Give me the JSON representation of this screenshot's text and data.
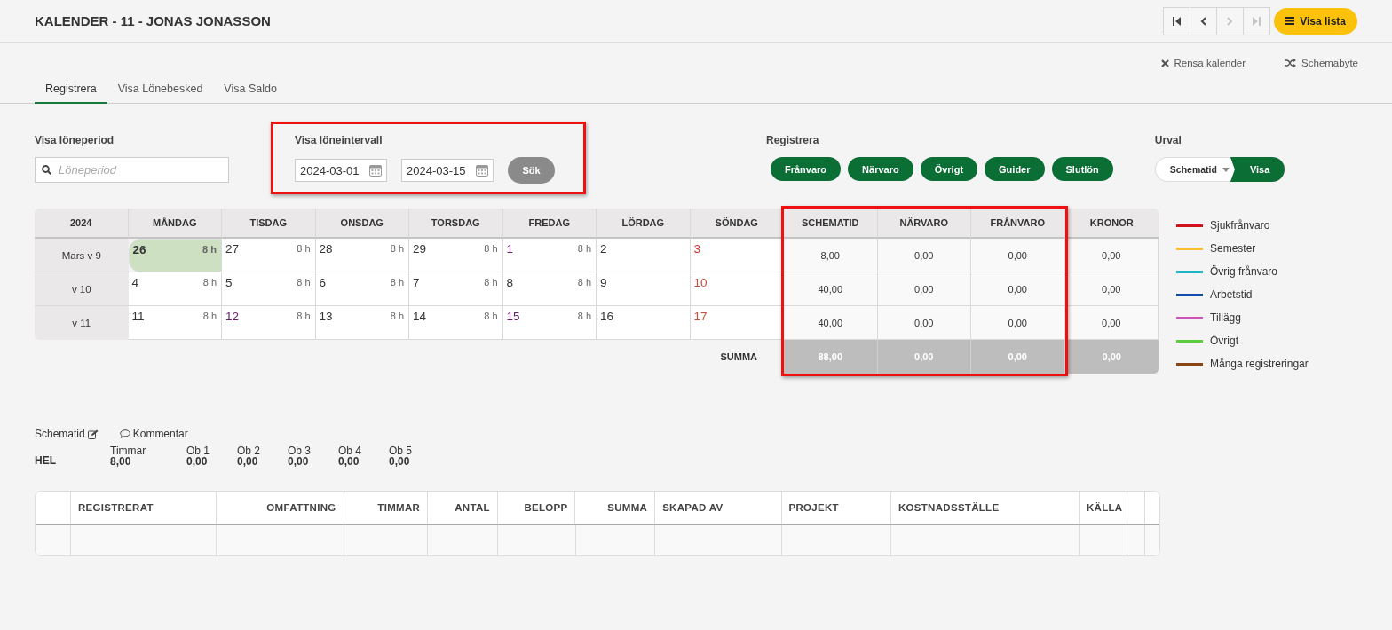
{
  "header": {
    "title": "KALENDER - 11 - JONAS JONASSON",
    "list_button": "Visa lista",
    "nav_buttons": [
      {
        "kind": "first",
        "disabled": false
      },
      {
        "kind": "prev",
        "disabled": false
      },
      {
        "kind": "next",
        "disabled": true
      },
      {
        "kind": "last",
        "disabled": true
      }
    ]
  },
  "actions": [
    {
      "kind": "clear",
      "label": "Rensa kalender"
    },
    {
      "kind": "shuffle",
      "label": "Schemabyte"
    }
  ],
  "tabs": [
    {
      "label": "Registrera",
      "selected": true
    },
    {
      "label": "Visa Lönebesked",
      "selected": false
    },
    {
      "label": "Visa Saldo",
      "selected": false
    }
  ],
  "period": {
    "label": "Visa löneperiod",
    "placeholder": "Löneperiod"
  },
  "interval": {
    "label": "Visa löneintervall",
    "from": "2024-03-01",
    "to": "2024-03-15",
    "button": "Sök",
    "highlighted": true
  },
  "register": {
    "label": "Registrera",
    "buttons": [
      "Frånvaro",
      "Närvaro",
      "Övrigt",
      "Guider",
      "Slutlön"
    ]
  },
  "selection": {
    "label": "Urval",
    "value": "Schematid",
    "button": "Visa"
  },
  "calendar": {
    "corner": "2024",
    "days": [
      "MÅNDAG",
      "TISDAG",
      "ONSDAG",
      "TORSDAG",
      "FREDAG",
      "LÖRDAG",
      "SÖNDAG"
    ],
    "summary_columns": [
      {
        "label": "SCHEMATID",
        "highlighted": true
      },
      {
        "label": "NÄRVARO",
        "highlighted": true
      },
      {
        "label": "FRÅNVARO",
        "highlighted": true
      },
      {
        "label": "KRONOR",
        "highlighted": false
      }
    ],
    "weeks": [
      {
        "label": "Mars v 9",
        "totals": [
          "8,00",
          "0,00",
          "0,00",
          "0,00"
        ],
        "days": [
          {
            "date": "26",
            "hours": "8 h",
            "selected": true,
            "color": "#333333"
          },
          {
            "date": "27",
            "hours": "8 h",
            "selected": false,
            "color": "#333333"
          },
          {
            "date": "28",
            "hours": "8 h",
            "selected": false,
            "color": "#333333"
          },
          {
            "date": "29",
            "hours": "8 h",
            "selected": false,
            "color": "#333333"
          },
          {
            "date": "1",
            "hours": "8 h",
            "selected": false,
            "color": "#6a1b6a"
          },
          {
            "date": "2",
            "selected": false,
            "color": "#333333"
          },
          {
            "date": "3",
            "selected": false,
            "color": "#d32f2f"
          }
        ]
      },
      {
        "label": "v 10",
        "totals": [
          "40,00",
          "0,00",
          "0,00",
          "0,00"
        ],
        "days": [
          {
            "date": "4",
            "hours": "8 h",
            "selected": false,
            "color": "#333333"
          },
          {
            "date": "5",
            "hours": "8 h",
            "selected": false,
            "color": "#333333"
          },
          {
            "date": "6",
            "hours": "8 h",
            "selected": false,
            "color": "#333333"
          },
          {
            "date": "7",
            "hours": "8 h",
            "selected": false,
            "color": "#333333"
          },
          {
            "date": "8",
            "hours": "8 h",
            "selected": false,
            "color": "#333333"
          },
          {
            "date": "9",
            "selected": false,
            "color": "#333333"
          },
          {
            "date": "10",
            "selected": false,
            "color": "#c0503a"
          }
        ]
      },
      {
        "label": "v 11",
        "totals": [
          "40,00",
          "0,00",
          "0,00",
          "0,00"
        ],
        "days": [
          {
            "date": "11",
            "hours": "8 h",
            "selected": false,
            "color": "#333333"
          },
          {
            "date": "12",
            "hours": "8 h",
            "selected": false,
            "color": "#6a1b6a"
          },
          {
            "date": "13",
            "hours": "8 h",
            "selected": false,
            "color": "#333333"
          },
          {
            "date": "14",
            "hours": "8 h",
            "selected": false,
            "color": "#333333"
          },
          {
            "date": "15",
            "hours": "8 h",
            "selected": false,
            "color": "#6a1b6a"
          },
          {
            "date": "16",
            "selected": false,
            "color": "#333333"
          },
          {
            "date": "17",
            "selected": false,
            "color": "#c0503a"
          }
        ]
      }
    ],
    "sum_label": "SUMMA",
    "sums": [
      "88,00",
      "0,00",
      "0,00",
      "0,00"
    ]
  },
  "legend": [
    {
      "label": "Sjukfrånvaro",
      "color": "#d0121b"
    },
    {
      "label": "Semester",
      "color": "#fbc02d"
    },
    {
      "label": "Övrig frånvaro",
      "color": "#1eb4c8"
    },
    {
      "label": "Arbetstid",
      "color": "#114fa6"
    },
    {
      "label": "Tillägg",
      "color": "#d150b8"
    },
    {
      "label": "Övrigt",
      "color": "#5ccc3c"
    },
    {
      "label": "Många registreringar",
      "color": "#8b4513"
    }
  ],
  "schedule": {
    "links": [
      {
        "kind": "edit",
        "label": "Schematid"
      },
      {
        "kind": "comment",
        "label": "Kommentar"
      }
    ],
    "type": "HEL",
    "figures": [
      {
        "label": "Timmar",
        "value": "8,00"
      },
      {
        "label": "Ob 1",
        "value": "0,00"
      },
      {
        "label": "Ob 2",
        "value": "0,00"
      },
      {
        "label": "Ob 3",
        "value": "0,00"
      },
      {
        "label": "Ob 4",
        "value": "0,00"
      },
      {
        "label": "Ob 5",
        "value": "0,00"
      }
    ]
  },
  "registrations": {
    "columns": [
      {
        "label": "REGISTRERAT",
        "kind": "text"
      },
      {
        "label": "OMFATTNING",
        "kind": "number"
      },
      {
        "label": "TIMMAR",
        "kind": "number"
      },
      {
        "label": "ANTAL",
        "kind": "number"
      },
      {
        "label": "BELOPP",
        "kind": "number"
      },
      {
        "label": "SUMMA",
        "kind": "number"
      },
      {
        "label": "SKAPAD AV",
        "kind": "text"
      },
      {
        "label": "PROJEKT",
        "kind": "text"
      },
      {
        "label": "KOSTNADSSTÄLLE",
        "kind": "text"
      },
      {
        "label": "KÄLLA",
        "kind": "text"
      }
    ]
  }
}
